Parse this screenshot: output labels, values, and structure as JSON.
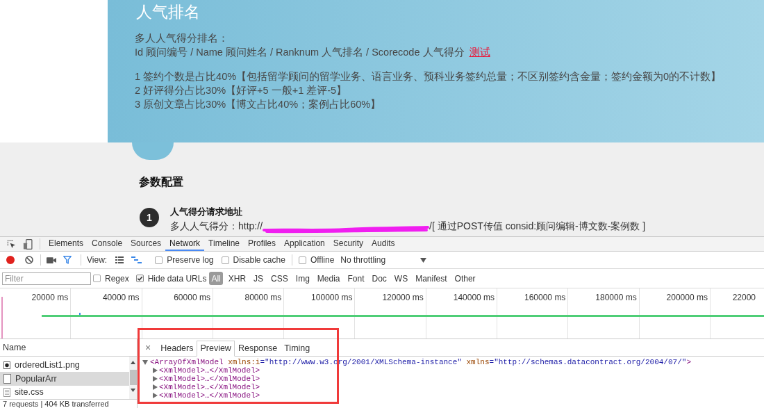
{
  "page_header": {
    "title": "人气排名",
    "intro": "多人人气得分排名：",
    "fields": "Id 顾问编号 / Name 顾问姓名 / Ranknum 人气排名 / Scorecode 人气得分",
    "test_link": "测试",
    "rules": [
      "1 签约个数是占比40%【包括留学顾问的留学业务、语言业务、预科业务签约总量；不区别签约含金量；签约金额为0的不计数】",
      "2 好评得分占比30%【好评+5 一般+1 差评-5】",
      "3 原创文章占比30%【博文占比40%；案例占比60%】"
    ]
  },
  "config": {
    "heading": "参数配置",
    "steps": [
      {
        "number": "1",
        "title": "人气得分请求地址",
        "text_before": "多人人气得分：http://",
        "text_after": "/[ 通过POST传值 consid:顾问编辑-博文数-案例数 ]"
      }
    ]
  },
  "devtools": {
    "panels": [
      {
        "label": "Elements",
        "selected": false
      },
      {
        "label": "Console",
        "selected": false
      },
      {
        "label": "Sources",
        "selected": false
      },
      {
        "label": "Network",
        "selected": true
      },
      {
        "label": "Timeline",
        "selected": false
      },
      {
        "label": "Profiles",
        "selected": false
      },
      {
        "label": "Application",
        "selected": false
      },
      {
        "label": "Security",
        "selected": false
      },
      {
        "label": "Audits",
        "selected": false
      }
    ],
    "toolbar": {
      "recording": true,
      "filter_shown": true,
      "view_label": "View:",
      "view_modes": [
        {
          "kind": "list",
          "selected": false
        },
        {
          "kind": "overview",
          "selected": true
        }
      ],
      "options": [
        {
          "label": "Preserve log",
          "checked": false
        },
        {
          "label": "Disable cache",
          "checked": false
        }
      ],
      "offline": {
        "label": "Offline",
        "checked": false
      },
      "throttling": "No throttling"
    },
    "filter_bar": {
      "placeholder": "Filter",
      "options": [
        {
          "label": "Regex",
          "checked": false
        },
        {
          "label": "Hide data URLs",
          "checked": true
        }
      ],
      "types": [
        {
          "label": "All",
          "selected": true
        },
        {
          "label": "XHR",
          "selected": false
        },
        {
          "label": "JS",
          "selected": false
        },
        {
          "label": "CSS",
          "selected": false
        },
        {
          "label": "Img",
          "selected": false
        },
        {
          "label": "Media",
          "selected": false
        },
        {
          "label": "Font",
          "selected": false
        },
        {
          "label": "Doc",
          "selected": false
        },
        {
          "label": "WS",
          "selected": false
        },
        {
          "label": "Manifest",
          "selected": false
        },
        {
          "label": "Other",
          "selected": false
        }
      ]
    },
    "overview": {
      "ticks": [
        "20000 ms",
        "40000 ms",
        "60000 ms",
        "80000 ms",
        "100000 ms",
        "120000 ms",
        "140000 ms",
        "160000 ms",
        "180000 ms",
        "200000 ms",
        "22000"
      ]
    },
    "requests": {
      "header": "Name",
      "rows": [
        {
          "name": "orderedList1.png",
          "kind": "image",
          "selected": false
        },
        {
          "name": "PopularArr",
          "kind": "document",
          "selected": true
        },
        {
          "name": "site.css",
          "kind": "stylesheet",
          "selected": false
        }
      ],
      "summary": "7 requests | 404 KB transferred"
    },
    "details": {
      "close": "×",
      "tabs": [
        {
          "label": "Headers",
          "selected": false
        },
        {
          "label": "Preview",
          "selected": true
        },
        {
          "label": "Response",
          "selected": false
        },
        {
          "label": "Timing",
          "selected": false
        }
      ],
      "preview": {
        "open": "<ArrayOfXmlModel",
        "attributes": [
          {
            "name": "xmlns:i",
            "value": "=\"http://www.w3.org/2001/XMLSchema-instance\""
          },
          {
            "name": "xmlns",
            "value": "=\"http://schemas.datacontract.org/2004/07/\""
          }
        ],
        "close": ">",
        "expanded": true,
        "children": [
          {
            "text": "<XmlModel>…</XmlModel>",
            "expanded": false
          },
          {
            "text": "<XmlModel>…</XmlModel>",
            "expanded": false
          },
          {
            "text": "<XmlModel>…</XmlModel>",
            "expanded": false
          },
          {
            "text": "<XmlModel>…</XmlModel>",
            "expanded": false
          }
        ]
      }
    }
  },
  "annotations": [
    {
      "kind": "rectangle"
    }
  ]
}
